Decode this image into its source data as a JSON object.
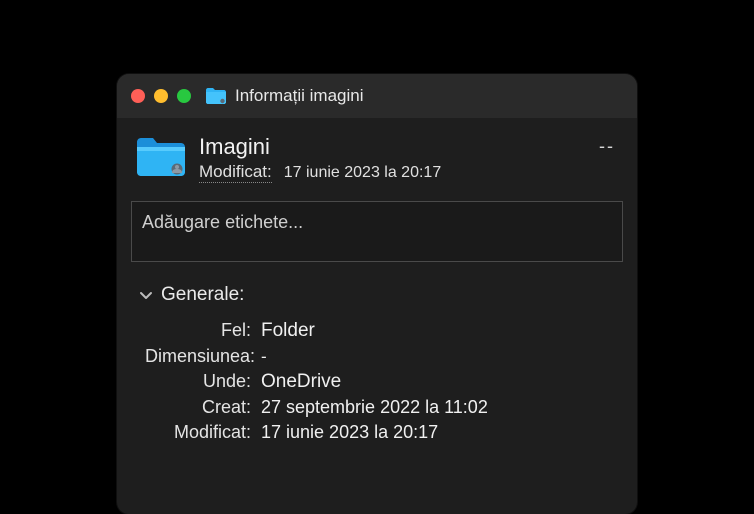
{
  "window": {
    "title": "Informații imagini"
  },
  "header": {
    "name": "Imagini",
    "modified_label": "Modificat:",
    "modified_value": "17 iunie 2023 la 20:17",
    "size_placeholder": "--"
  },
  "tags": {
    "placeholder": "Adăugare etichete..."
  },
  "sections": {
    "general": {
      "title": "Generale:",
      "rows": {
        "kind_label": "Fel:",
        "kind_value": "Folder",
        "size_label": "Dimensiunea:",
        "size_value": "-",
        "where_label": "Unde:",
        "where_value": "OneDrive",
        "created_label": "Creat:",
        "created_value": "27 septembrie 2022 la 11:02",
        "modified_label": "Modificat:",
        "modified_value": "17 iunie 2023 la 20:17"
      }
    }
  },
  "colors": {
    "folder": "#2FB4F4",
    "folder_dark": "#1C8FD9"
  }
}
